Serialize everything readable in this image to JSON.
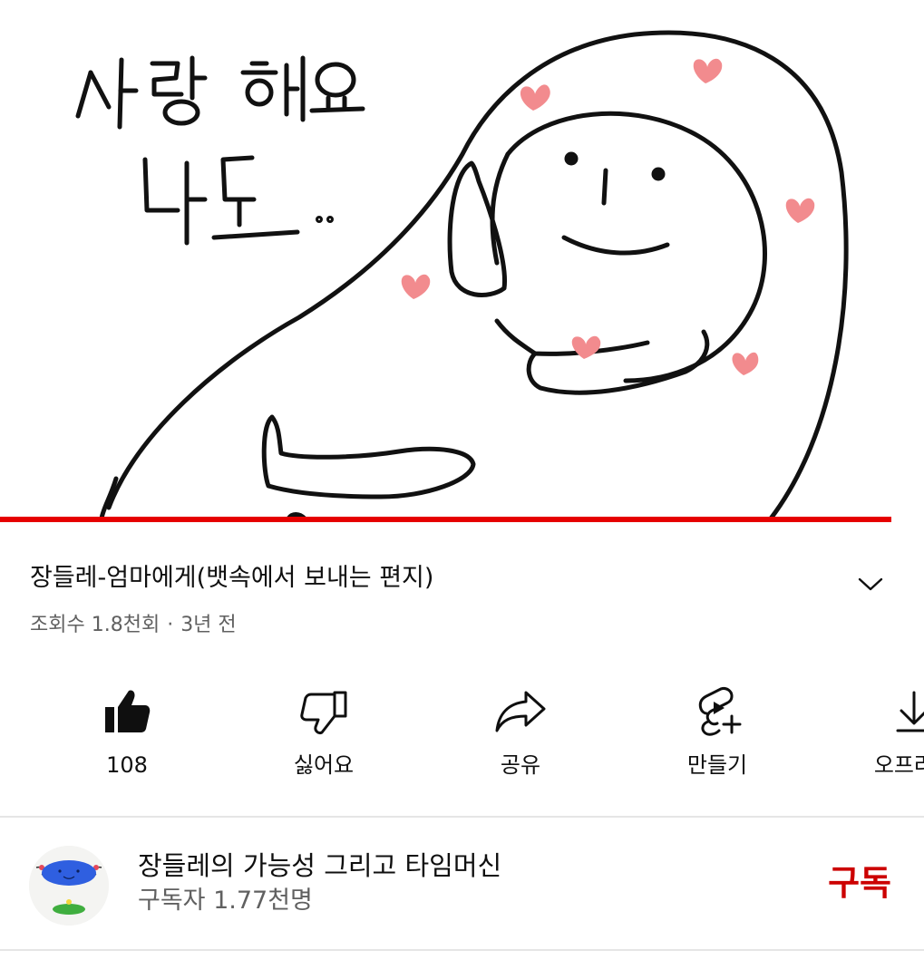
{
  "video": {
    "progress": 0.965,
    "progress_color": "#e60000"
  },
  "title": {
    "text": "장들레-엄마에게(뱃속에서 보내는 편지)",
    "expand_icon": "chevron-down-icon"
  },
  "meta": {
    "views": "조회수 1.8천회",
    "separator": "·",
    "age": "3년 전"
  },
  "actions": [
    {
      "label": "108",
      "icon": "thumbs-up-filled-icon"
    },
    {
      "label": "싫어요",
      "icon": "thumbs-down-icon"
    },
    {
      "label": "공유",
      "icon": "share-icon"
    },
    {
      "label": "만들기",
      "icon": "shorts-create-icon"
    },
    {
      "label": "오프라인",
      "icon": "download-icon"
    }
  ],
  "channel": {
    "name": "장들레의 가능성 그리고 타임머신",
    "subscribers": "구독자 1.77천명",
    "subscribe_label": "구독",
    "subscribe_color": "#cc0000"
  }
}
